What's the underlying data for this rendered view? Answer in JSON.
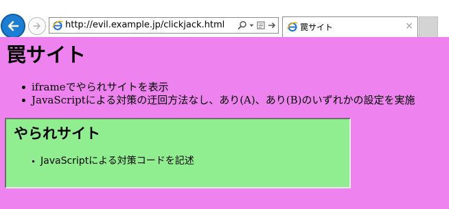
{
  "browser": {
    "url": "http://evil.example.jp/clickjack.html",
    "tab_title": "罠サイト",
    "tab_close": "×"
  },
  "page": {
    "title": "罠サイト",
    "bullets": [
      "iframeでやられサイトを表示",
      "JavaScriptによる対策の迂回方法なし、あり(A)、あり(B)のいずれかの設定を実施"
    ]
  },
  "iframe": {
    "title": "やられサイト",
    "bullets": [
      "JavaScriptによる対策コードを記述"
    ]
  },
  "colors": {
    "trap_page_background": "#ee82ee",
    "framed_page_background": "#90ee90",
    "back_button": "#1b7ed3"
  },
  "icons": [
    "back-arrow-icon",
    "forward-arrow-icon",
    "ie-page-icon",
    "search-icon",
    "dropdown-icon",
    "compatibility-view-icon",
    "refresh-icon"
  ]
}
